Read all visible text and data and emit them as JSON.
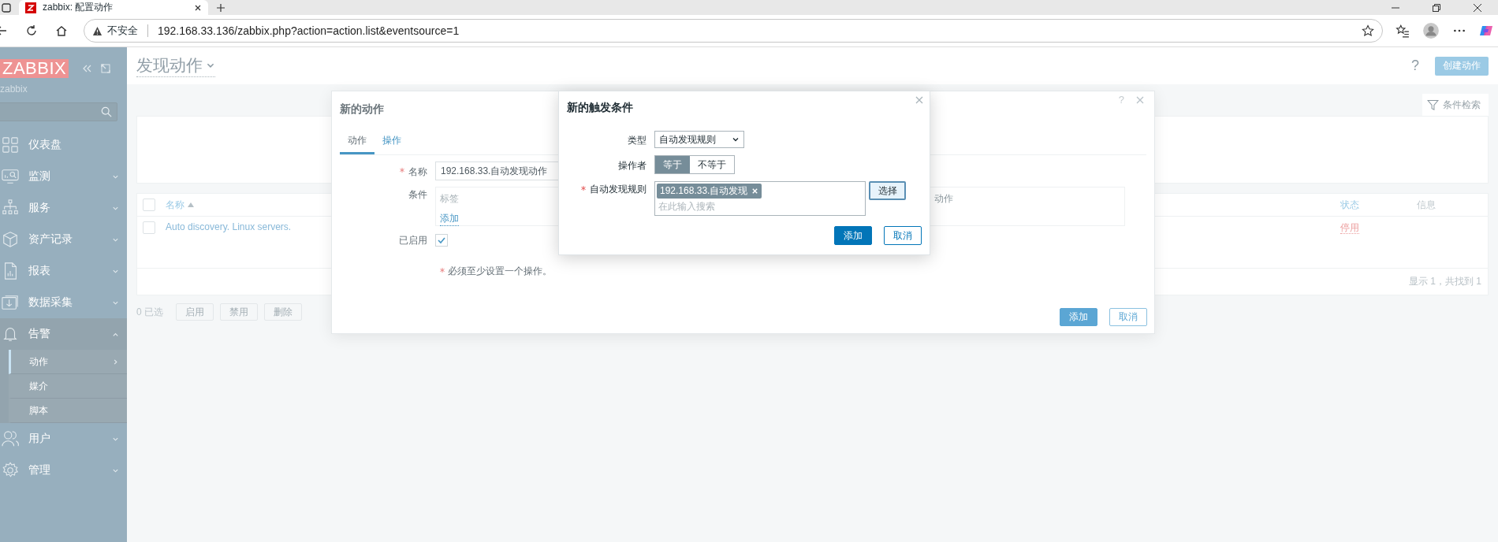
{
  "browser": {
    "tab_title": "zabbix: 配置动作",
    "security": "不安全",
    "url": "192.168.33.136/zabbix.php?action=action.list&eventsource=1"
  },
  "sidebar": {
    "logo": "ZABBIX",
    "server": "zabbix",
    "items": [
      {
        "label": "仪表盘",
        "kind": "link",
        "expanded": false
      },
      {
        "label": "监测",
        "kind": "menu",
        "expanded": false
      },
      {
        "label": "服务",
        "kind": "menu",
        "expanded": false
      },
      {
        "label": "资产记录",
        "kind": "menu",
        "expanded": false
      },
      {
        "label": "报表",
        "kind": "menu",
        "expanded": false
      },
      {
        "label": "数据采集",
        "kind": "menu",
        "expanded": false
      },
      {
        "label": "告警",
        "kind": "menu",
        "expanded": true,
        "children": [
          {
            "label": "动作",
            "selected": true
          },
          {
            "label": "媒介",
            "selected": false
          },
          {
            "label": "脚本",
            "selected": false
          }
        ]
      },
      {
        "label": "用户",
        "kind": "menu",
        "expanded": false
      },
      {
        "label": "管理",
        "kind": "menu",
        "expanded": false
      }
    ]
  },
  "page": {
    "title": "发现动作",
    "help": "?",
    "create_button": "创建动作",
    "filter_tab": "条件检索",
    "table": {
      "select_all": false,
      "columns": [
        {
          "label": "名称",
          "sorted": true
        },
        {
          "label": "状态",
          "sorted": false
        },
        {
          "label": "信息",
          "sorted": false
        }
      ],
      "rows": [
        {
          "checked": false,
          "name": "Auto discovery. Linux servers.",
          "status": "停用"
        }
      ],
      "footer": "显示 1，共找到 1"
    },
    "selection": "0 已选",
    "actions": [
      {
        "label": "启用",
        "disabled": true
      },
      {
        "label": "禁用",
        "disabled": true
      },
      {
        "label": "删除",
        "disabled": true
      }
    ]
  },
  "action_dialog": {
    "title": "新的动作",
    "help": "?",
    "tabs": [
      {
        "label": "动作",
        "selected": true
      },
      {
        "label": "操作",
        "selected": false
      }
    ],
    "name_label": "名称",
    "name_required": true,
    "name_value": "192.168.33.自动发现动作",
    "conditions_label": "条件",
    "condition_columns": [
      "标签",
      "动作"
    ],
    "conditions_add": "添加",
    "enabled_label": "已启用",
    "enabled": true,
    "note": "必须至少设置一个操作。",
    "note_required": true,
    "buttons": [
      {
        "label": "添加",
        "kind": "primary"
      },
      {
        "label": "取消",
        "kind": "secondary"
      }
    ]
  },
  "condition_dialog": {
    "title": "新的触发条件",
    "type_label": "类型",
    "type_value": "自动发现规则",
    "operator_label": "操作者",
    "operators": [
      {
        "label": "等于",
        "selected": true
      },
      {
        "label": "不等于",
        "selected": false
      }
    ],
    "rule_label": "自动发现规则",
    "rule_required": true,
    "rule_tags": [
      "192.168.33.自动发现"
    ],
    "rule_placeholder": "在此输入搜索",
    "select_button": "选择",
    "buttons": [
      {
        "label": "添加",
        "kind": "primary"
      },
      {
        "label": "取消",
        "kind": "secondary"
      }
    ]
  }
}
